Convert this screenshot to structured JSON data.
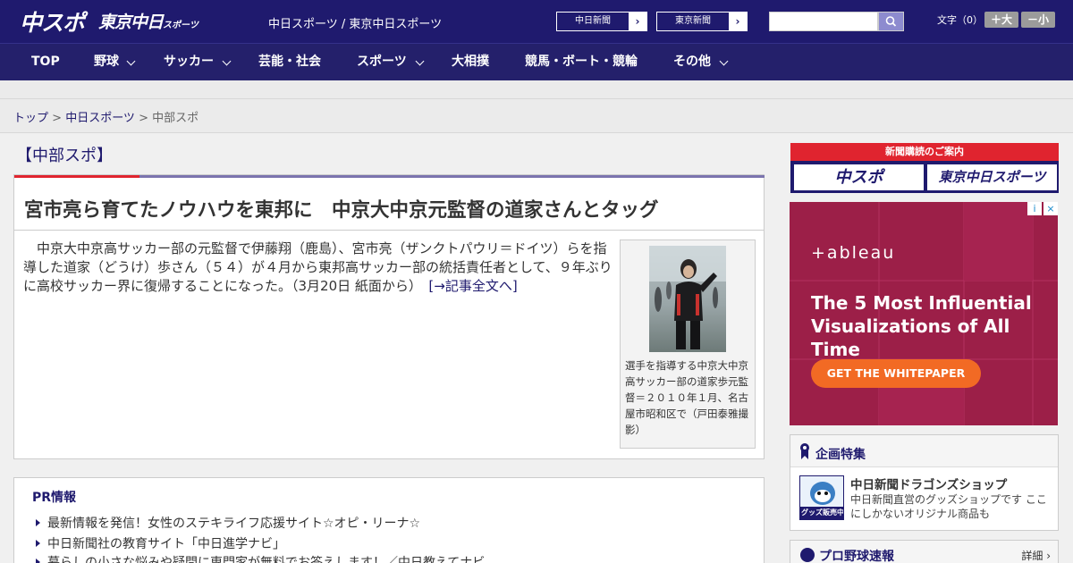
{
  "header": {
    "logo_main": "中スポ",
    "logo_tokyo": "東京中日",
    "logo_tokyo_small": "スポーツ",
    "site_names": "中日スポーツ / 東京中日スポーツ",
    "btn_chunichi": "中日新聞",
    "btn_tokyo": "東京新聞",
    "btn_arrow": "›",
    "search_placeholder": "",
    "fontsize_label": "文字（0）",
    "fontsize_up": "＋大",
    "fontsize_down": "－小"
  },
  "nav": {
    "items": [
      {
        "label": "TOP"
      },
      {
        "label": "野球"
      },
      {
        "label": "サッカー"
      },
      {
        "label": "芸能・社会"
      },
      {
        "label": "スポーツ"
      },
      {
        "label": "大相撲"
      },
      {
        "label": "競馬・ボート・競輪"
      },
      {
        "label": "その他"
      }
    ]
  },
  "breadcrumb": {
    "home": "トップ",
    "sep": " > ",
    "section": "中日スポーツ",
    "current": "中部スポ"
  },
  "section_title": "【中部スポ】",
  "article": {
    "headline": "宮市亮ら育てたノウハウを東邦に　中京大中京元監督の道家さんとタッグ",
    "lead": "中京大中京高サッカー部の元監督で伊藤翔（鹿島）、宮市亮（ザンクトパウリ＝ドイツ）らを指導した道家（どうけ）歩さん（５４）が４月から東邦高サッカー部の統括責任者として、９年ぶりに高校サッカー界に復帰することになった。（3月20日 紙面から）　",
    "more_link": "[→記事全文へ]",
    "photo_caption": "選手を指導する中京大中京高サッカー部の道家歩元監督＝２０１０年１月、名古屋市昭和区で（戸田泰雅撮影）"
  },
  "pr": {
    "title": "PR情報",
    "items": [
      "最新情報を発信！女性のステキライフ応援サイト☆オピ・リーナ☆",
      "中日新聞社の教育サイト「中日進学ナビ」",
      "暮らしの小さな悩みや疑問に専門家が無料でお答えします！／中日教えてナビ"
    ]
  },
  "sidebar": {
    "subscribe_title": "新聞購読のご案内",
    "subscribe_btn1": "中スポ",
    "subscribe_btn2": "東京中日スポーツ",
    "ad": {
      "brand": "+ableau",
      "headline": "The 5 Most Influential Visualizations of All Time",
      "cta": "GET THE WHITEPAPER",
      "info": "i",
      "close": "×",
      "color": "#9c1f48"
    },
    "feature": {
      "title": "企画特集",
      "shop_name": "中日新聞ドラゴンズショップ",
      "shop_desc": "中日新聞直営のグッズショップです ここにしかないオリジナル商品も",
      "shop_badge": "グッズ販売中"
    },
    "baseball": {
      "title": "プロ野球速報",
      "more": "詳細 ›"
    }
  },
  "colors": {
    "brand_navy": "#1f1a6e",
    "accent_red": "#e0242f"
  }
}
